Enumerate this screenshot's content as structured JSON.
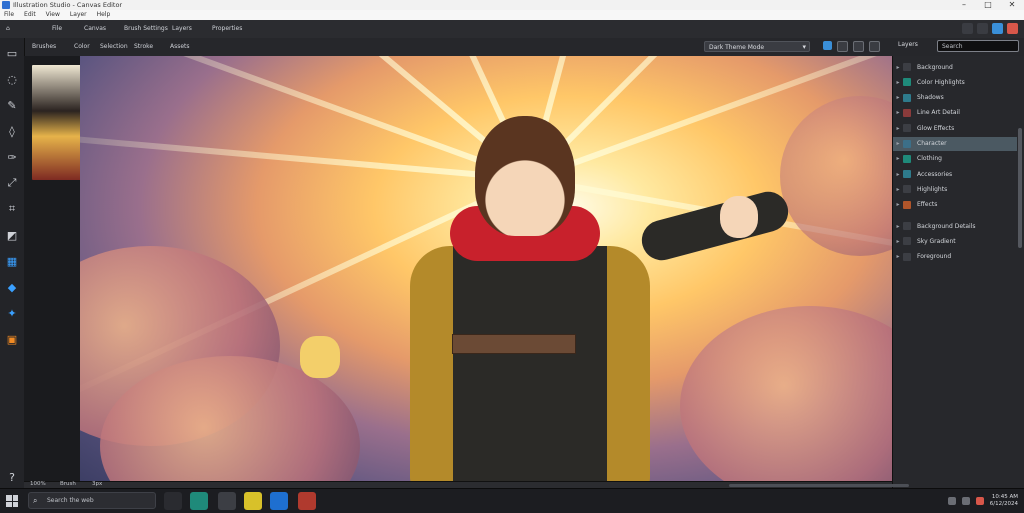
{
  "window": {
    "title": "Illustration Studio - Canvas Editor",
    "controls": [
      "–",
      "□",
      "✕"
    ]
  },
  "menubar": [
    "File",
    "Edit",
    "View",
    "Layer",
    "Help"
  ],
  "toolbar1": {
    "items": [
      "File",
      "Canvas",
      "Brush Settings",
      "Layers",
      "Properties"
    ]
  },
  "toolbar2": {
    "items": [
      "Brushes",
      "Color",
      "Selection",
      "Stroke",
      "Assets"
    ],
    "dropdown_value": "Dark Theme Mode",
    "dropdown_icon": "chevron-down-icon",
    "layers_select": "Layers",
    "panel_search": "Search"
  },
  "left_tools": [
    {
      "icon": "select-icon",
      "glyph": "▭",
      "color": "#cfd2d8"
    },
    {
      "icon": "lasso-icon",
      "glyph": "◌",
      "color": "#cfd2d8"
    },
    {
      "icon": "brush-icon",
      "glyph": "✎",
      "color": "#cfd2d8"
    },
    {
      "icon": "eraser-icon",
      "glyph": "◊",
      "color": "#cfd2d8"
    },
    {
      "icon": "pen-icon",
      "glyph": "✑",
      "color": "#cfd2d8"
    },
    {
      "icon": "transform-icon",
      "glyph": "⤢",
      "color": "#cfd2d8"
    },
    {
      "icon": "crop-icon",
      "glyph": "⌗",
      "color": "#cfd2d8"
    },
    {
      "icon": "shape-icon",
      "glyph": "◩",
      "color": "#cfd2d8"
    },
    {
      "icon": "grid-icon",
      "glyph": "▦",
      "color": "#3aa0ff"
    },
    {
      "icon": "fill-icon",
      "glyph": "◆",
      "color": "#3aa0ff"
    },
    {
      "icon": "picker-icon",
      "glyph": "✦",
      "color": "#3aa0ff"
    },
    {
      "icon": "stamp-icon",
      "glyph": "▣",
      "color": "#f08a24"
    }
  ],
  "thumbnails": [
    "character-ref-1",
    "character-ref-2",
    "character-ref-3"
  ],
  "layers": [
    {
      "label": "Background",
      "color": "#3c3e44"
    },
    {
      "label": "Color Highlights",
      "color": "#1f8a7a"
    },
    {
      "label": "Shadows",
      "color": "#2e7b8c"
    },
    {
      "label": "Line Art Detail",
      "color": "#8a3b3b"
    },
    {
      "label": "Glow Effects",
      "color": "#3c3e44"
    },
    {
      "label": "Character",
      "color": "#3c6f88",
      "selected": true
    },
    {
      "label": "Clothing",
      "color": "#1f8a7a"
    },
    {
      "label": "Accessories",
      "color": "#2e7b8c"
    },
    {
      "label": "Highlights",
      "color": "#3c3e44"
    },
    {
      "label": "Effects",
      "color": "#b0552a"
    },
    {
      "label": "Background Details",
      "color": "#3c3e44"
    },
    {
      "label": "Sky Gradient",
      "color": "#3c3e44"
    },
    {
      "label": "Foreground",
      "color": "#3c3e44"
    }
  ],
  "statusbar": {
    "zoom": "100%",
    "tool": "Brush",
    "size": "3px"
  },
  "taskbar": {
    "search_placeholder": "Search the web",
    "apps": [
      {
        "icon": "file-explorer-icon",
        "color": "#2a2b30"
      },
      {
        "icon": "edge-browser-icon",
        "color": "#1f8a7a"
      },
      {
        "icon": "photo-app-icon",
        "color": "#3c3e44"
      },
      {
        "icon": "notes-app-icon",
        "color": "#d8c12a"
      },
      {
        "icon": "studio-app-icon",
        "color": "#1e6fd0"
      },
      {
        "icon": "art-app-icon",
        "color": "#b03a2e"
      }
    ],
    "time": "10:45 AM",
    "date": "6/12/2024"
  }
}
